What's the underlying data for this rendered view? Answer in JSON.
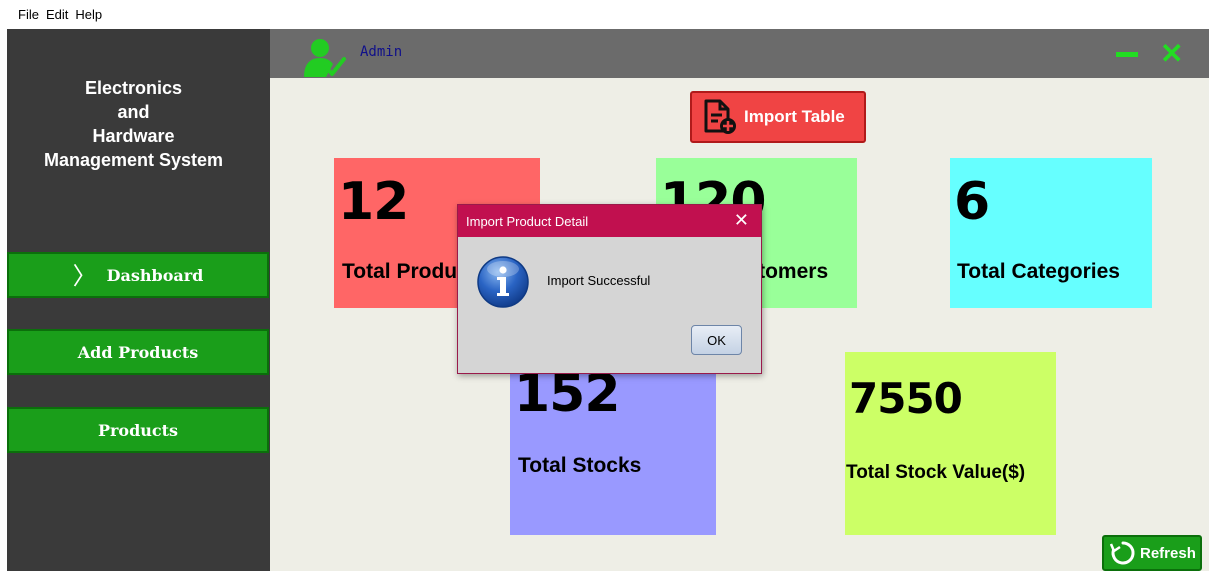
{
  "menu": {
    "file": "File",
    "edit": "Edit",
    "help": "Help"
  },
  "sidebar": {
    "title_lines": [
      "Electronics",
      "and",
      "Hardware",
      "Management System"
    ],
    "items": [
      {
        "label": "Dashboard",
        "active": true
      },
      {
        "label": "Add Products"
      },
      {
        "label": "Products"
      }
    ]
  },
  "header": {
    "user": "Admin"
  },
  "main": {
    "import_label": "Import Table",
    "refresh_label": "Refresh",
    "cards": [
      {
        "value": "12",
        "label": "Total Products",
        "color": "#ff6666"
      },
      {
        "value": "120",
        "label": "Total Customers",
        "color": "#99ff99"
      },
      {
        "value": "6",
        "label": "Total Categories",
        "color": "#66ffff"
      },
      {
        "value": "152",
        "label": "Total Stocks",
        "color": "#9999ff"
      },
      {
        "value": "7550",
        "label": "Total Stock Value($)",
        "color": "#ccff66"
      }
    ]
  },
  "dialog": {
    "title": "Import Product Detail",
    "message": "Import Successful",
    "ok_label": "OK",
    "icon": "info-icon"
  },
  "colors": {
    "sidebar_bg": "#3a3a3a",
    "nav_green": "#1a9e1a",
    "topbar": "#6b6b6b",
    "dialog_title": "#c1104f",
    "accent_green": "#22dd22"
  }
}
